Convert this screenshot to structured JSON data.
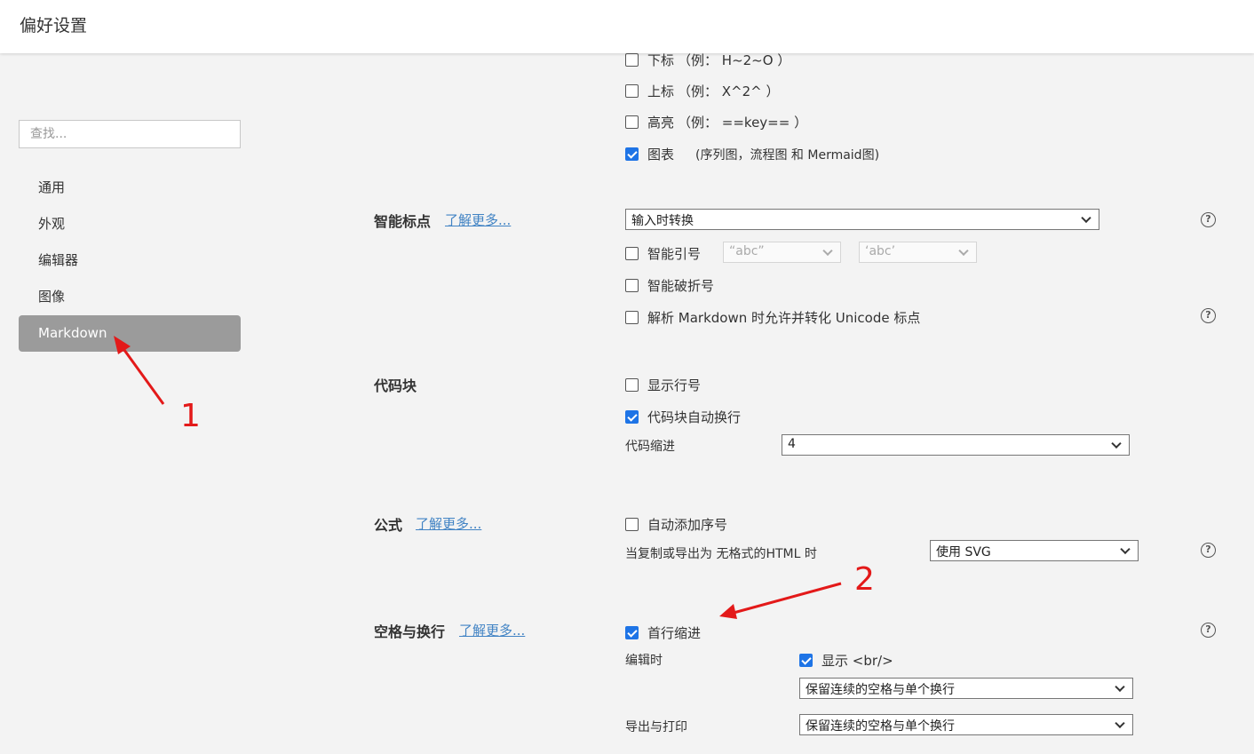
{
  "window": {
    "title": "偏好设置"
  },
  "sidebar": {
    "search_placeholder": "查找...",
    "items": [
      {
        "label": "通用",
        "active": false
      },
      {
        "label": "外观",
        "active": false
      },
      {
        "label": "编辑器",
        "active": false
      },
      {
        "label": "图像",
        "active": false
      },
      {
        "label": "Markdown",
        "active": true
      }
    ]
  },
  "extensions": {
    "subscript": {
      "label": "下标",
      "example": "（例： H~2~O ）",
      "checked": false
    },
    "superscript": {
      "label": "上标",
      "example": "（例： X^2^ ）",
      "checked": false
    },
    "highlight": {
      "label": "高亮",
      "example": "（例： ==key== ）",
      "checked": false
    },
    "diagrams": {
      "label": "图表",
      "note": "(序列图，流程图 和 Mermaid图)",
      "checked": true
    }
  },
  "smart_punct": {
    "title": "智能标点",
    "learn_more": "了解更多...",
    "mode": "输入时转换",
    "smart_quotes": {
      "label": "智能引号",
      "checked": false,
      "double": "“abc”",
      "single": "‘abc’"
    },
    "smart_dashes": {
      "label": "智能破折号",
      "checked": false
    },
    "unicode_punct": {
      "label": "解析 Markdown 时允许并转化 Unicode 标点",
      "checked": false
    }
  },
  "code_block": {
    "title": "代码块",
    "line_numbers": {
      "label": "显示行号",
      "checked": false
    },
    "wrap": {
      "label": "代码块自动换行",
      "checked": true
    },
    "indent_label": "代码缩进",
    "indent_value": "4"
  },
  "math": {
    "title": "公式",
    "learn_more": "了解更多...",
    "auto_number": {
      "label": "自动添加序号",
      "checked": false
    },
    "copy_export_label": "当复制或导出为 无格式的HTML 时",
    "copy_export_value": "使用 SVG"
  },
  "whitespace": {
    "title": "空格与换行",
    "learn_more": "了解更多...",
    "first_indent": {
      "label": "首行缩进",
      "checked": true
    },
    "editing_label": "编辑时",
    "show_br": {
      "label": "显示 <br/>",
      "checked": true
    },
    "editing_value": "保留连续的空格与单个换行",
    "export_label": "导出与打印",
    "export_value": "保留连续的空格与单个换行"
  },
  "annotations": {
    "one": "1",
    "two": "2",
    "color": "#e31919"
  },
  "help_icon": "?",
  "colors": {
    "accent": "#1e74e6",
    "active_nav": "#9b9b9b",
    "link": "#4183c4"
  }
}
